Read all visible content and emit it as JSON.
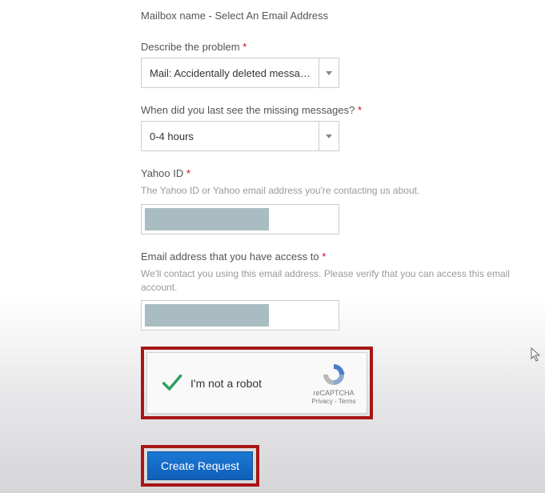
{
  "heading": "Mailbox name - Select An Email Address",
  "fields": {
    "problem": {
      "label": "Describe the problem",
      "required": "*",
      "selected": "Mail: Accidentally deleted messa…"
    },
    "lastSeen": {
      "label": "When did you last see the missing messages?",
      "required": "*",
      "selected": "0-4 hours"
    },
    "yahooId": {
      "label": "Yahoo ID",
      "required": "*",
      "helper": "The Yahoo ID or Yahoo email address you're contacting us about."
    },
    "accessEmail": {
      "label": "Email address that you have access to",
      "required": "*",
      "helper": "We'll contact you using this email address. Please verify that you can access this email account."
    }
  },
  "captcha": {
    "label": "I'm not a robot",
    "brand": "reCAPTCHA",
    "privacy": "Privacy",
    "sep": " - ",
    "terms": "Terms"
  },
  "submit": {
    "label": "Create Request"
  }
}
